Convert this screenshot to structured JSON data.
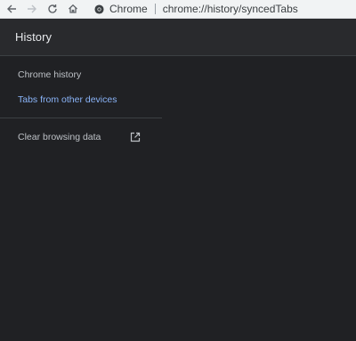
{
  "browser": {
    "back_icon": "arrow-left-icon",
    "forward_icon": "arrow-right-icon",
    "reload_icon": "reload-icon",
    "home_icon": "home-icon",
    "site_label": "Chrome",
    "url": "chrome://history/syncedTabs"
  },
  "header": {
    "title": "History"
  },
  "sidebar": {
    "items": [
      {
        "label": "Chrome history",
        "active": false
      },
      {
        "label": "Tabs from other devices",
        "active": true
      }
    ],
    "clear_data": {
      "label": "Clear browsing data",
      "icon": "open-in-new-icon"
    }
  },
  "colors": {
    "background": "#202124",
    "header_bg": "#292a2d",
    "accent": "#8ab4f8",
    "text": "#bdc1c6",
    "title": "#e8eaed"
  }
}
